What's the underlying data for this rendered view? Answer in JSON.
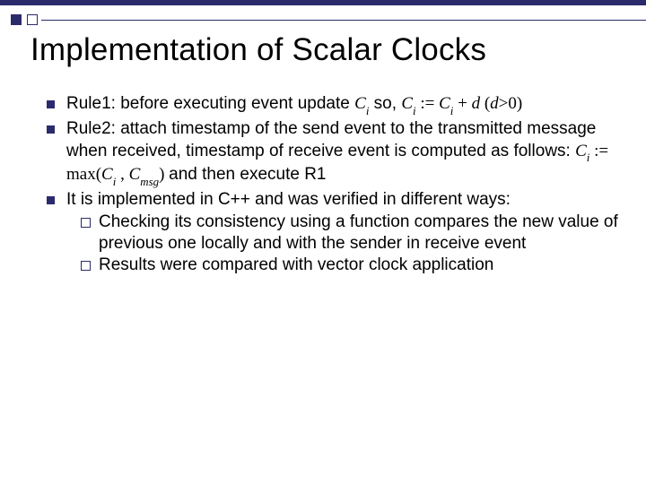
{
  "title": "Implementation of Scalar Clocks",
  "bullets": {
    "b1_pre": "Rule1: before executing event update ",
    "b1_ci1": "C",
    "b1_i1": "i",
    "b1_mid1": " so, ",
    "b1_ci2": "C",
    "b1_i2": "i",
    "b1_assign": " := ",
    "b1_ci3": "C",
    "b1_i3": "i",
    "b1_plus": " + ",
    "b1_d": "d",
    "b1_paren_open": " (",
    "b1_d2": "d",
    "b1_gt0": ">0)",
    "b2_pre": "Rule2:       attach timestamp of the send event to the transmitted message when received,  timestamp of receive event is computed as follows: ",
    "b2_ci1": "C",
    "b2_i1": "i",
    "b2_assign": " := max(",
    "b2_ci2": "C",
    "b2_i2": "i",
    "b2_comma": " , ",
    "b2_cmsg": "C",
    "b2_msg": "msg",
    "b2_close": ") ",
    "b2_tail": "and then execute R1",
    "b3": "It is implemented in C++ and was verified in different ways:",
    "b3a": "Checking its consistency using a function compares the new value of previous one locally and with the sender in receive event",
    "b3b": "Results were compared with vector clock  application"
  }
}
